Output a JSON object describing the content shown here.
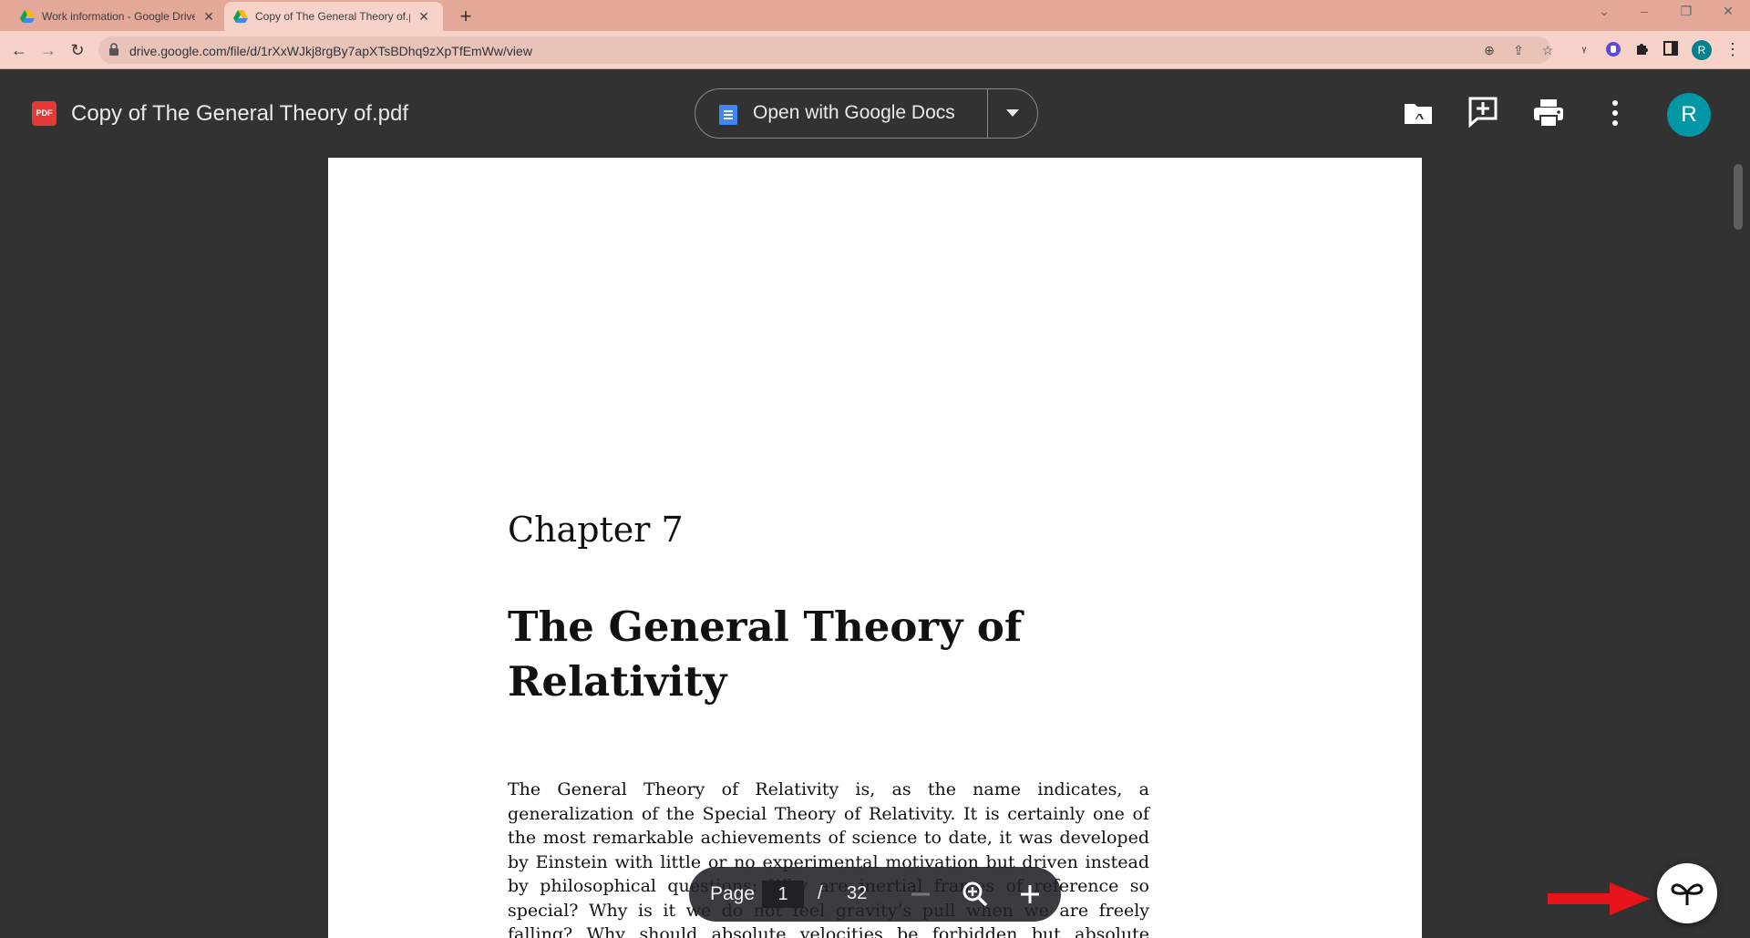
{
  "browser": {
    "tabs": [
      {
        "title": "Work information - Google Drive",
        "active": false
      },
      {
        "title": "Copy of The General Theory of.pdf",
        "active": true
      }
    ],
    "url": "drive.google.com/file/d/1rXxWJkj8rgBy7apXTsBDhq9zXpTfEmWw/view",
    "profile_initial": "R"
  },
  "viewer": {
    "file_type_badge": "PDF",
    "file_title": "Copy of The General Theory of.pdf",
    "open_with_label": "Open with Google Docs",
    "avatar_initial": "R"
  },
  "document": {
    "chapter": "Chapter 7",
    "title": "The General Theory of Relativity",
    "body": "The General Theory of Relativity is, as the name indicates, a generalization of the Special Theory of Relativity. It is certainly one of the most remarkable achievements of science to date, it was developed by Einstein with little or no experimental motivation but driven instead by philosophical questions: Why are inertial frames of reference so special? Why is it we do not feel gravity’s pull when we are freely falling? Why should absolute velocities be forbidden but absolute accelerations by accepted?"
  },
  "pager": {
    "label": "Page",
    "current": "1",
    "separator": "/",
    "total": "32"
  },
  "colors": {
    "tab_strip": "#e4a898",
    "toolbar": "#f6d2c8",
    "viewer_bg": "#323232",
    "avatar": "#0097a7",
    "pdf_badge": "#e53935",
    "arrow": "#e8141c"
  }
}
